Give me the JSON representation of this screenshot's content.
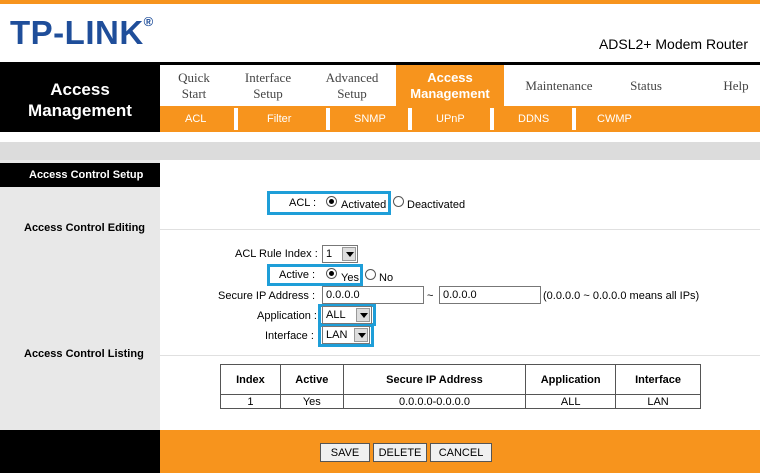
{
  "brand": {
    "logo": "TP-LINK",
    "reg": "®",
    "model": "ADSL2+ Modem Router"
  },
  "side_title": {
    "line1": "Access",
    "line2": "Management"
  },
  "nav": [
    {
      "line1": "Quick",
      "line2": "Start"
    },
    {
      "line1": "Interface",
      "line2": "Setup"
    },
    {
      "line1": "Advanced",
      "line2": "Setup"
    },
    {
      "line1": "Access",
      "line2": "Management"
    },
    {
      "line1": "Maintenance",
      "line2": ""
    },
    {
      "line1": "Status",
      "line2": ""
    },
    {
      "line1": "Help",
      "line2": ""
    }
  ],
  "subnav": [
    "ACL",
    "Filter",
    "SNMP",
    "UPnP",
    "DDNS",
    "CWMP"
  ],
  "sections": {
    "setup": "Access Control Setup",
    "editing": "Access Control Editing",
    "listing": "Access Control Listing"
  },
  "form": {
    "acl_label": "ACL :",
    "activated": "Activated",
    "deactivated": "Deactivated",
    "rule_index_label": "ACL Rule Index :",
    "rule_index_value": "1",
    "active_label": "Active :",
    "yes": "Yes",
    "no": "No",
    "secure_ip_label": "Secure IP Address :",
    "ip_start": "0.0.0.0",
    "tilde": "~",
    "ip_end": "0.0.0.0",
    "ip_hint": "(0.0.0.0 ~ 0.0.0.0 means all IPs)",
    "application_label": "Application :",
    "application_value": "ALL",
    "interface_label": "Interface :",
    "interface_value": "LAN"
  },
  "table": {
    "headers": [
      "Index",
      "Active",
      "Secure IP Address",
      "Application",
      "Interface"
    ],
    "rows": [
      [
        "1",
        "Yes",
        "0.0.0.0-0.0.0.0",
        "ALL",
        "LAN"
      ]
    ]
  },
  "buttons": {
    "save": "SAVE",
    "delete": "DELETE",
    "cancel": "CANCEL"
  },
  "colors": {
    "accent": "#f7941d",
    "highlight": "#1e9ed8",
    "brand": "#1f4e9a"
  }
}
